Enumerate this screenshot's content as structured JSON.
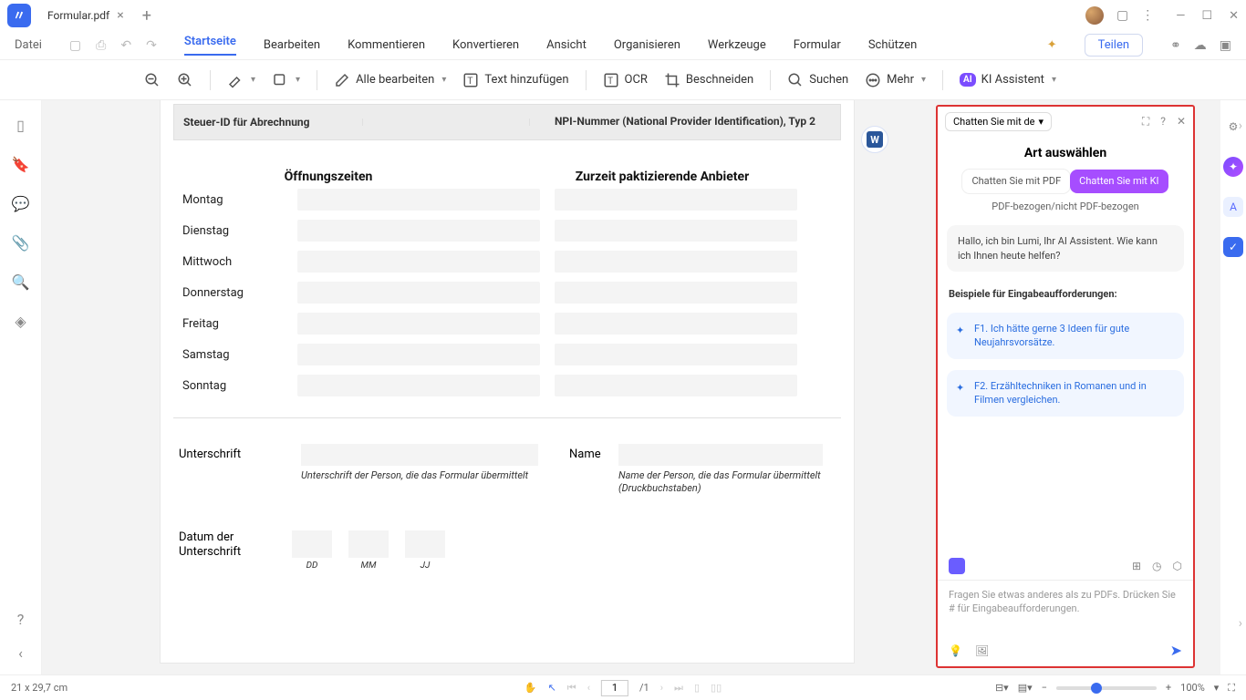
{
  "app": {
    "tab_title": "Formular.pdf"
  },
  "menu": {
    "file": "Datei",
    "items": [
      "Startseite",
      "Bearbeiten",
      "Kommentieren",
      "Konvertieren",
      "Ansicht",
      "Organisieren",
      "Werkzeuge",
      "Formular",
      "Schützen"
    ],
    "share": "Teilen"
  },
  "toolbar": {
    "edit_all": "Alle bearbeiten",
    "add_text": "Text hinzufügen",
    "ocr": "OCR",
    "crop": "Beschneiden",
    "search": "Suchen",
    "more": "Mehr",
    "ai_assist": "KI Assistent"
  },
  "doc": {
    "hdr_left": "Steuer-ID für Abrechnung",
    "hdr_right": "NPI-Nummer (National Provider Identification), Typ 2",
    "hours_title": "Öffnungszeiten",
    "providers_title": "Zurzeit paktizierende Anbieter",
    "days": [
      "Montag",
      "Dienstag",
      "Mittwoch",
      "Donnerstag",
      "Freitag",
      "Samstag",
      "Sonntag"
    ],
    "sig_label": "Unterschrift",
    "sig_cap": "Unterschrift der Person, die das Formular übermittelt",
    "name_label": "Name",
    "name_cap": "Name der Person, die das Formular übermittelt (Druckbuchstaben)",
    "date_label": "Datum der Unterschrift",
    "dd": "DD",
    "mm": "MM",
    "jj": "JJ"
  },
  "ai": {
    "dropdown": "Chatten Sie mit de",
    "title": "Art auswählen",
    "tab_pdf": "Chatten Sie mit PDF",
    "tab_ki": "Chatten Sie mit KI",
    "sub": "PDF-bezogen/nicht PDF-bezogen",
    "greeting": "Hallo, ich bin Lumi, Ihr AI Assistent. Wie kann ich Ihnen heute helfen?",
    "examples_hdr": "Beispiele für Eingabeaufforderungen:",
    "ex1": "F1. Ich hätte gerne 3 Ideen für gute Neujahrsvorsätze.",
    "ex2": "F2. Erzähltechniken in Romanen und in Filmen vergleichen.",
    "input_placeholder": "Fragen Sie etwas anderes als zu PDFs. Drücken Sie # für Eingabeaufforderungen."
  },
  "status": {
    "dims": "21 x 29,7 cm",
    "page": "1",
    "pages": "/1",
    "zoom": "100%"
  }
}
